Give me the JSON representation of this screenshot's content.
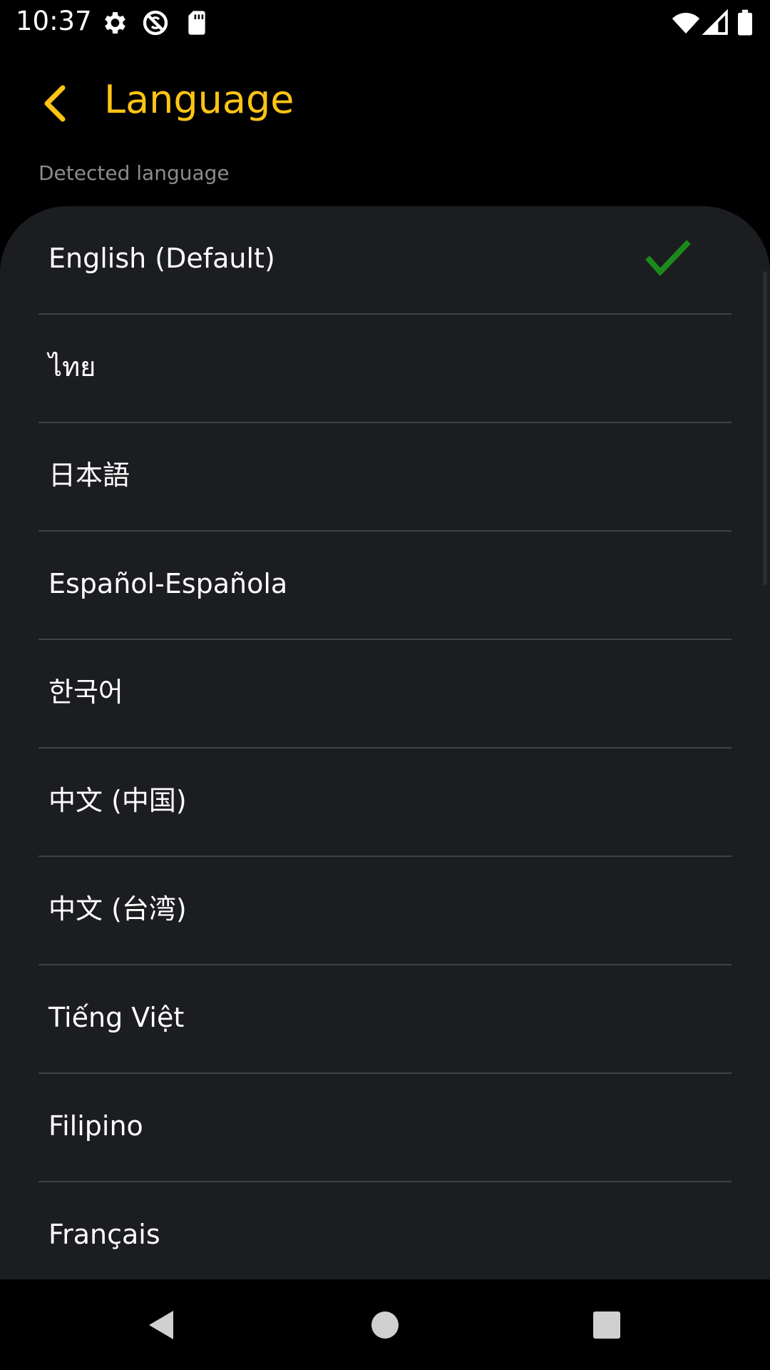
{
  "status_bar": {
    "time": "10:37",
    "left_icons": [
      "gear-icon",
      "no-sync-icon",
      "sd-card-icon"
    ],
    "right_icons": [
      "wifi-icon",
      "cell-signal-icon",
      "battery-icon"
    ]
  },
  "header": {
    "title": "Language",
    "back_icon": "chevron-left-icon",
    "accent_color": "#FFC415"
  },
  "section": {
    "label": "Detected language"
  },
  "languages": [
    {
      "label": "English (Default)",
      "selected": true
    },
    {
      "label": "ไทย",
      "selected": false
    },
    {
      "label": "日本語",
      "selected": false
    },
    {
      "label": "Español-Española",
      "selected": false
    },
    {
      "label": "한국어",
      "selected": false
    },
    {
      "label": "中文 (中国)",
      "selected": false
    },
    {
      "label": "中文 (台湾)",
      "selected": false
    },
    {
      "label": "Tiếng Việt",
      "selected": false
    },
    {
      "label": "Filipino",
      "selected": false
    },
    {
      "label": "Français",
      "selected": false
    }
  ],
  "check_color": "#1a8a1a",
  "nav_bar": {
    "buttons": [
      "back-triangle-icon",
      "home-circle-icon",
      "recents-square-icon"
    ]
  }
}
